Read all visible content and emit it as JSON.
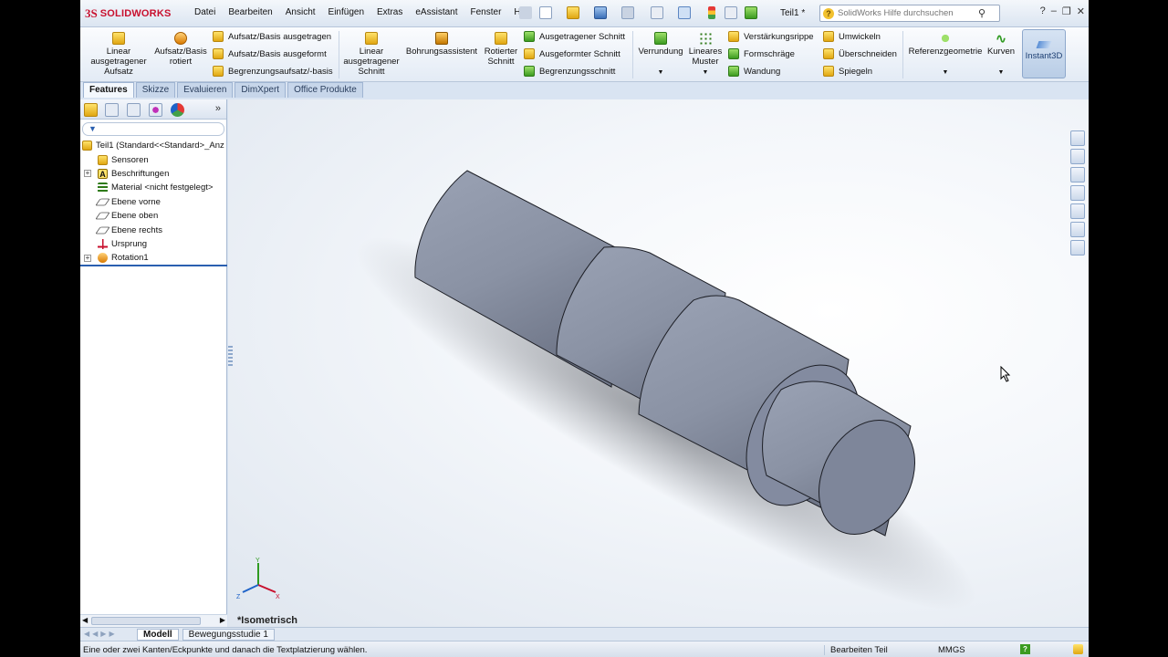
{
  "app": {
    "logo_mark": "3S",
    "logo_text": "SOLIDWORKS",
    "document_title": "Teil1 *"
  },
  "menu": [
    "Datei",
    "Bearbeiten",
    "Ansicht",
    "Einfügen",
    "Extras",
    "eAssistant",
    "Fenster",
    "Hilfe"
  ],
  "search": {
    "placeholder": "SolidWorks Hilfe durchsuchen"
  },
  "ribbon": {
    "linear_boss": "Linear ausgetragener Aufsatz",
    "revolved_boss": "Aufsatz/Basis rotiert",
    "swept_boss": "Aufsatz/Basis ausgetragen",
    "lofted_boss": "Aufsatz/Basis ausgeformt",
    "boundary_boss": "Begrenzungsaufsatz/-basis",
    "linear_cut": "Linear ausgetragener Schnitt",
    "hole_wizard": "Bohrungsassistent",
    "revolved_cut": "Rotierter Schnitt",
    "swept_cut": "Ausgetragener Schnitt",
    "lofted_cut": "Ausgeformter Schnitt",
    "boundary_cut": "Begrenzungsschnitt",
    "fillet": "Verrundung",
    "linear_pattern": "Lineares Muster",
    "rib": "Verstärkungsrippe",
    "draft": "Formschräge",
    "shell": "Wandung",
    "wrap": "Umwickeln",
    "intersect": "Überschneiden",
    "mirror": "Spiegeln",
    "ref_geometry": "Referenzgeometrie",
    "curves": "Kurven",
    "instant3d": "Instant3D"
  },
  "tabs": [
    "Features",
    "Skizze",
    "Evaluieren",
    "DimXpert",
    "Office Produkte"
  ],
  "tree": [
    {
      "label": "Teil1  (Standard<<Standard>_Anz",
      "icon": "part-icon",
      "level": 0,
      "expander": false
    },
    {
      "label": "Sensoren",
      "icon": "sensor-icon",
      "level": 1,
      "expander": false
    },
    {
      "label": "Beschriftungen",
      "icon": "annotations-icon",
      "level": 1,
      "expander": true
    },
    {
      "label": "Material <nicht festgelegt>",
      "icon": "material-icon",
      "level": 1,
      "expander": false
    },
    {
      "label": "Ebene vorne",
      "icon": "plane-icon",
      "level": 1,
      "expander": false
    },
    {
      "label": "Ebene oben",
      "icon": "plane-icon",
      "level": 1,
      "expander": false
    },
    {
      "label": "Ebene rechts",
      "icon": "plane-icon",
      "level": 1,
      "expander": false
    },
    {
      "label": "Ursprung",
      "icon": "origin-icon",
      "level": 1,
      "expander": false
    },
    {
      "label": "Rotation1",
      "icon": "revolve-icon",
      "level": 1,
      "expander": true
    }
  ],
  "viewport": {
    "view_name": "*Isometrisch",
    "model_color": "#8e96a8",
    "triad_labels": [
      "Y",
      "X",
      "Z"
    ]
  },
  "bottom_tabs": [
    "Modell",
    "Bewegungsstudie 1"
  ],
  "status": {
    "message": "Eine oder zwei Kanten/Eckpunkte und danach die Textplatzierung wählen.",
    "mode": "Bearbeiten Teil",
    "units": "MMGS",
    "help_icon": "?"
  }
}
